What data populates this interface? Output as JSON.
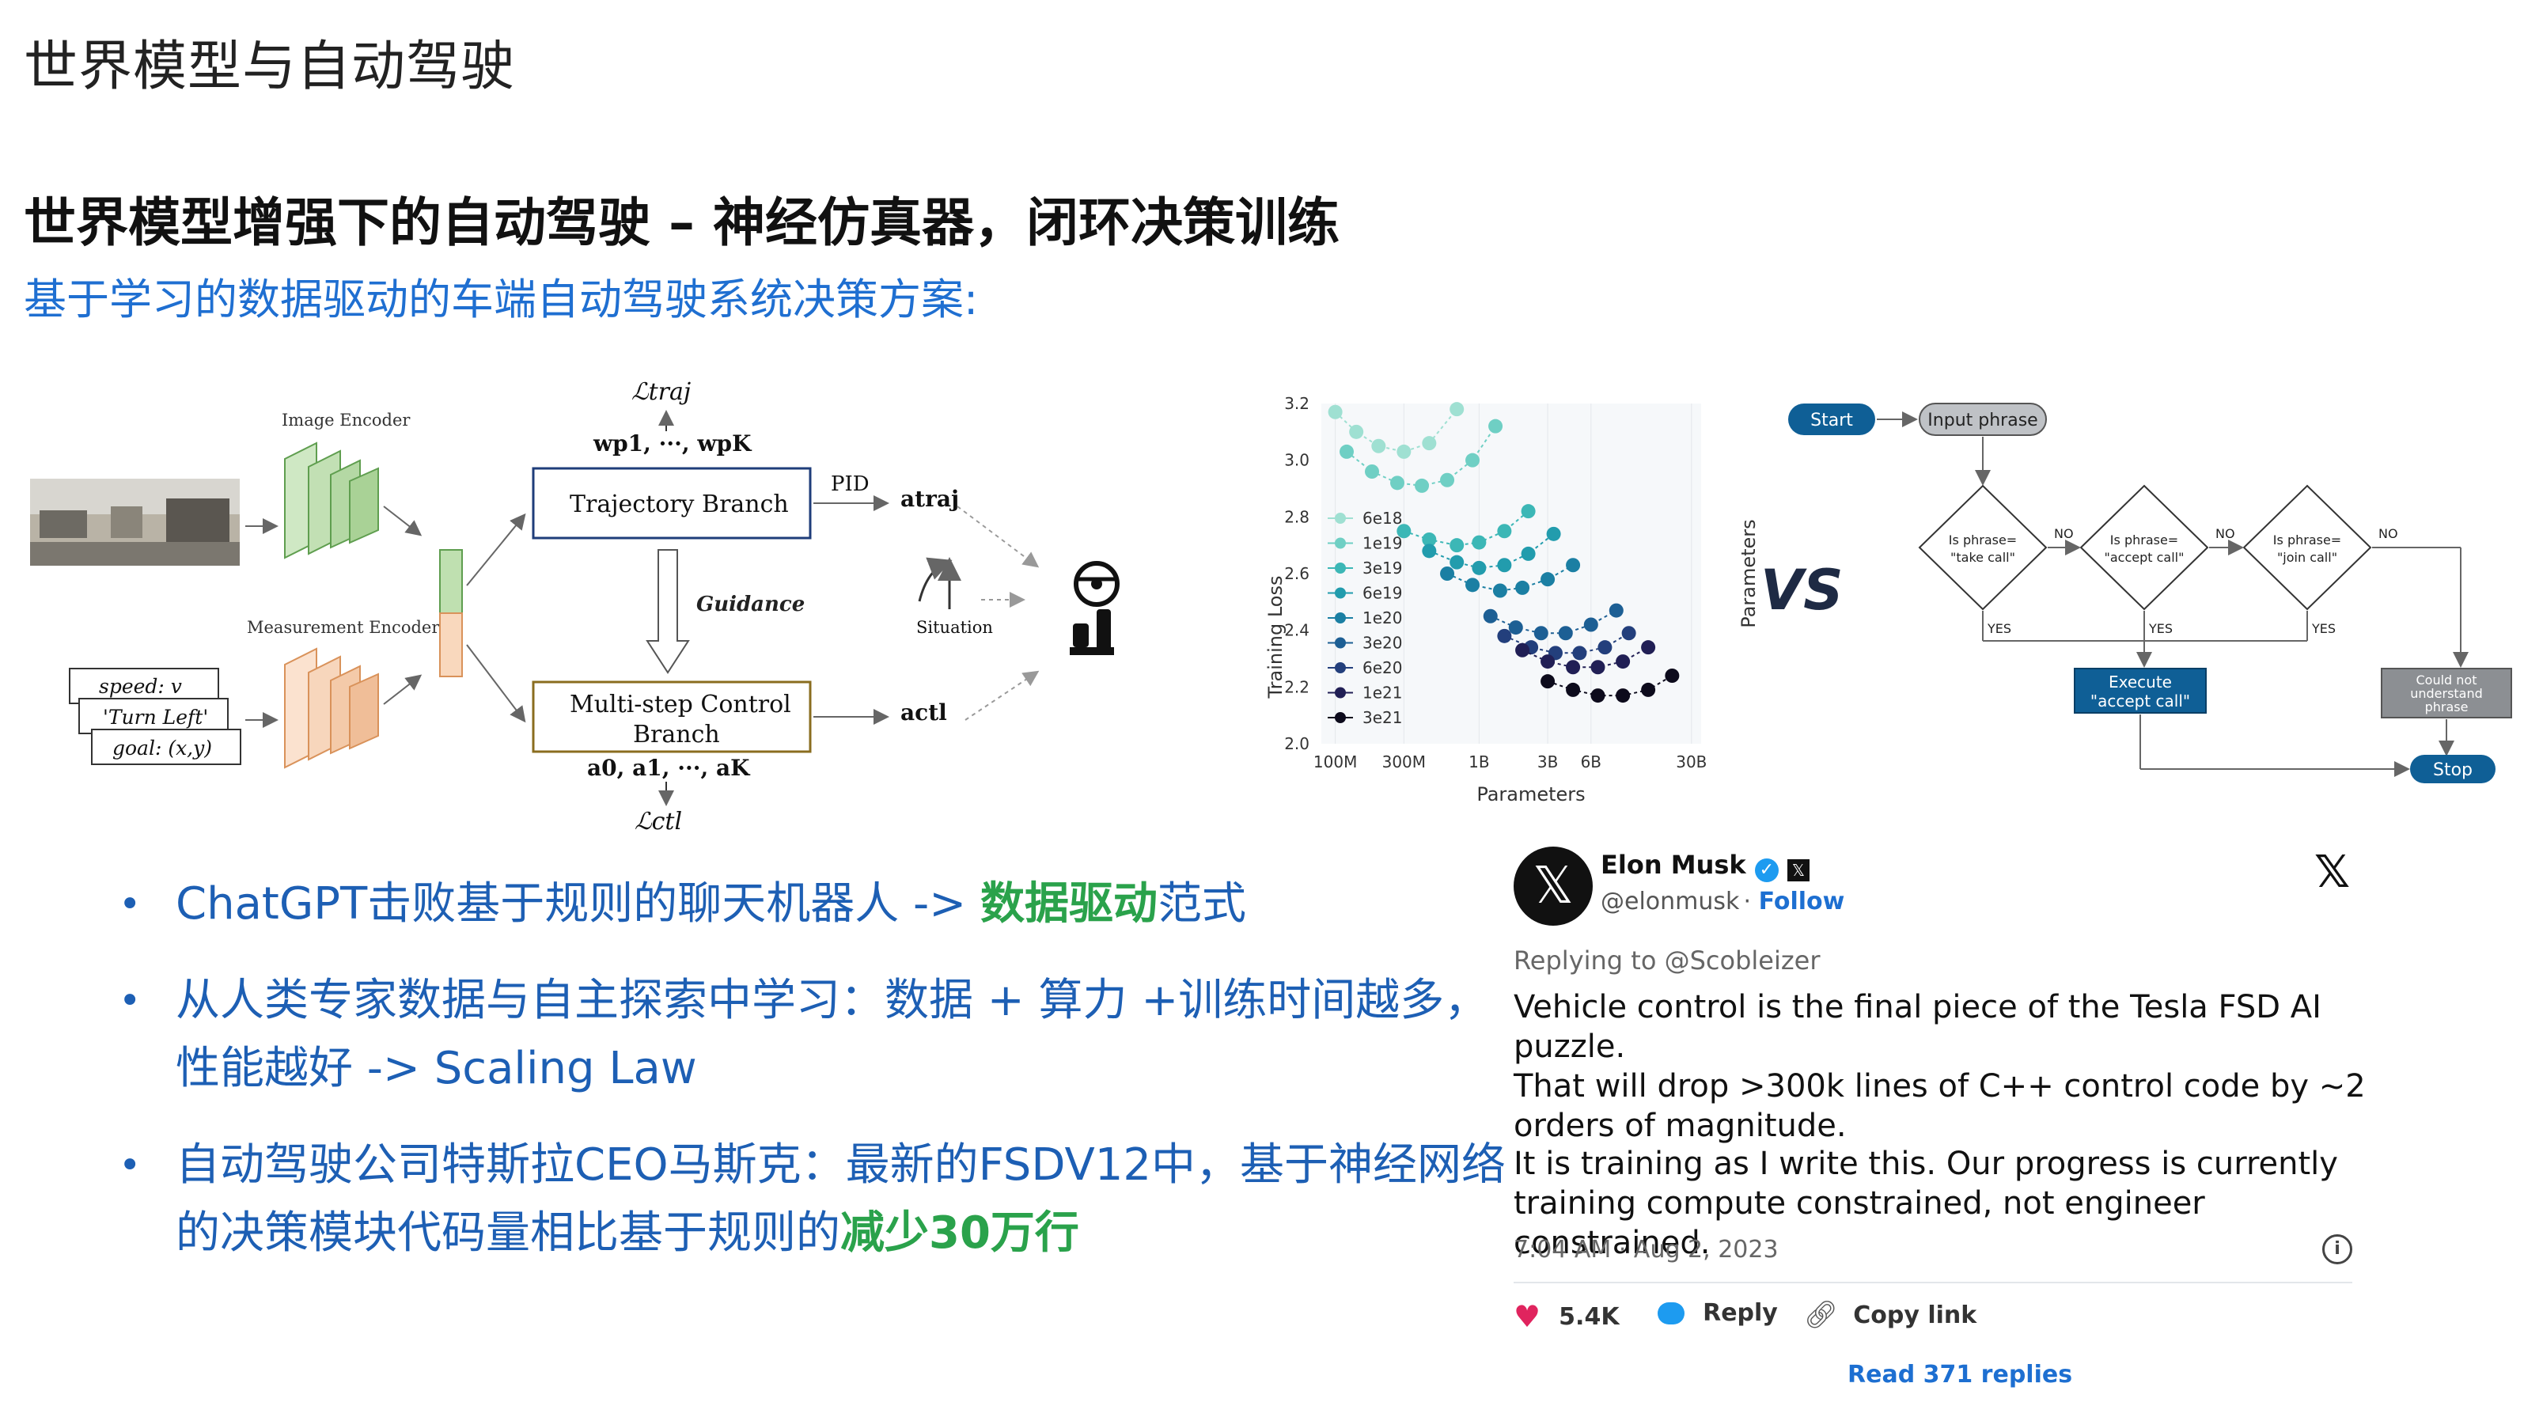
{
  "page_title": "世界模型与自动驾驶",
  "heading": "世界模型增强下的自动驾驶 – 神经仿真器，闭环决策训练",
  "subheading": "基于学习的数据驱动的车端自动驾驶系统决策方案:",
  "diagram_left": {
    "image_encoder": "Image Encoder",
    "measurement_encoder": "Measurement Encoder",
    "inputs": [
      "speed: v",
      "'Turn Left'",
      "goal: (x,y)"
    ],
    "loss_traj": "ℒtraj",
    "wp_label": "wp1, ···, wpK",
    "trajectory_branch": "Trajectory Branch",
    "pid": "PID",
    "a_traj": "atraj",
    "guidance": "Guidance",
    "situation": "Situation",
    "control_branch_line1": "Multi-step Control",
    "control_branch_line2": "Branch",
    "a_list": "a0, a1, ···, aK",
    "a_ctl": "actl",
    "loss_ctl": "ℒctl"
  },
  "chart_data": {
    "type": "scatter",
    "xlabel": "Parameters",
    "ylabel": "Training Loss",
    "right_label": "Parameters",
    "x_ticks": [
      "100M",
      "300M",
      "1B",
      "3B",
      "6B",
      "30B"
    ],
    "y_ticks": [
      "2.0",
      "2.2",
      "2.4",
      "2.6",
      "2.8",
      "3.0",
      "3.2"
    ],
    "ylim": [
      2.0,
      3.2
    ],
    "legend": [
      "6e18",
      "1e19",
      "3e19",
      "6e19",
      "1e20",
      "3e20",
      "6e20",
      "1e21",
      "3e21"
    ],
    "legend_colors": [
      "#9fe0d2",
      "#6fcfc4",
      "#3cb7b6",
      "#229cad",
      "#1b7fa3",
      "#1d5f94",
      "#233f7c",
      "#211f55",
      "#0d0b1c"
    ],
    "series": [
      {
        "name": "6e18",
        "x": [
          0.1,
          0.14,
          0.2,
          0.3,
          0.45,
          0.7
        ],
        "y": [
          3.17,
          3.1,
          3.05,
          3.03,
          3.06,
          3.18
        ]
      },
      {
        "name": "1e19",
        "x": [
          0.12,
          0.18,
          0.27,
          0.4,
          0.6,
          0.9,
          1.3
        ],
        "y": [
          3.03,
          2.96,
          2.92,
          2.91,
          2.93,
          3.0,
          3.12
        ]
      },
      {
        "name": "3e19",
        "x": [
          0.3,
          0.45,
          0.7,
          1.0,
          1.5,
          2.2
        ],
        "y": [
          2.75,
          2.72,
          2.7,
          2.71,
          2.75,
          2.82
        ]
      },
      {
        "name": "6e19",
        "x": [
          0.45,
          0.7,
          1.0,
          1.5,
          2.2,
          3.3
        ],
        "y": [
          2.68,
          2.64,
          2.62,
          2.63,
          2.67,
          2.74
        ]
      },
      {
        "name": "1e20",
        "x": [
          0.6,
          0.9,
          1.4,
          2.0,
          3.0,
          4.5
        ],
        "y": [
          2.6,
          2.56,
          2.54,
          2.55,
          2.58,
          2.63
        ]
      },
      {
        "name": "3e20",
        "x": [
          1.2,
          1.8,
          2.7,
          4.0,
          6.0,
          9.0
        ],
        "y": [
          2.45,
          2.41,
          2.39,
          2.39,
          2.42,
          2.47
        ]
      },
      {
        "name": "6e20",
        "x": [
          1.5,
          2.3,
          3.4,
          5.0,
          7.5,
          11.0
        ],
        "y": [
          2.38,
          2.34,
          2.32,
          2.32,
          2.34,
          2.39
        ]
      },
      {
        "name": "1e21",
        "x": [
          2.0,
          3.0,
          4.5,
          6.7,
          10.0,
          15.0
        ],
        "y": [
          2.33,
          2.29,
          2.27,
          2.27,
          2.29,
          2.34
        ]
      },
      {
        "name": "3e21",
        "x": [
          3.0,
          4.5,
          6.7,
          10.0,
          15.0,
          22.0
        ],
        "y": [
          2.22,
          2.19,
          2.17,
          2.17,
          2.19,
          2.24
        ]
      }
    ]
  },
  "vs_label": "VS",
  "flowchart": {
    "start": "Start",
    "input_phrase": "Input phrase",
    "decision1": [
      "Is phrase=",
      "\"take call\""
    ],
    "decision2": [
      "Is phrase=",
      "\"accept call\""
    ],
    "decision3": [
      "Is phrase=",
      "\"join call\""
    ],
    "no": "NO",
    "yes": "YES",
    "execute": [
      "Execute",
      "\"accept call\""
    ],
    "could_not": [
      "Could not",
      "understand",
      "phrase"
    ],
    "stop": "Stop"
  },
  "bullets": {
    "b1_text": "ChatGPT击败基于规则的聊天机器人 -> ",
    "b1_highlight": "数据驱动",
    "b1_tail": "范式",
    "b2_line1": "从人类专家数据与自主探索中学习：数据 + 算力 +训练时间越多，",
    "b2_line2": "性能越好 -> Scaling Law",
    "b3_line1": "自动驾驶公司特斯拉CEO马斯克：最新的FSDV12中，基于神经网络",
    "b3_line2": "的决策模块代码量相比基于规则的",
    "b3_highlight": "减少30万行"
  },
  "tweet": {
    "name": "Elon Musk",
    "handle": "@elonmusk",
    "follow": "Follow",
    "replying": "Replying to @Scobleizer",
    "body1_line1": "Vehicle control is the final piece of the Tesla FSD AI puzzle.",
    "body1_line2": "That will drop >300k lines of C++ control code by ~2",
    "body1_line3": "orders of magnitude.",
    "body2_line1": "It is training as I write this. Our progress is currently",
    "body2_line2": "training compute constrained, not engineer constrained.",
    "timestamp": "7:04 AM · Aug 2, 2023",
    "likes": "5.4K",
    "reply": "Reply",
    "copy_link": "Copy link",
    "read_replies": "Read 371 replies"
  }
}
